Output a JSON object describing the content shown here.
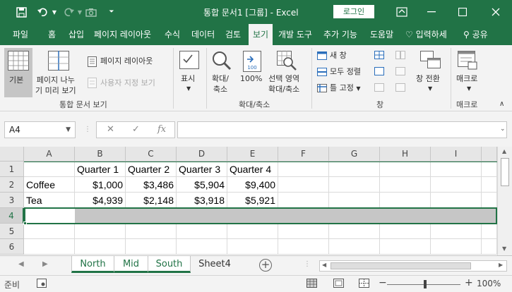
{
  "titlebar": {
    "title": "통합 문서1  [그룹]  -  Excel",
    "login_label": "로그인",
    "save_icon": "save-icon",
    "undo_icon": "undo-icon",
    "redo_icon": "redo-icon",
    "camera_icon": "camera-icon",
    "customize_icon": "customize-qat-icon"
  },
  "tabs": [
    "파일",
    "홈",
    "삽입",
    "페이지 레이아웃",
    "수식",
    "데이터",
    "검토",
    "보기",
    "개발 도구",
    "추가 기능",
    "도움말"
  ],
  "active_tab": "보기",
  "tell_me": "입력하세",
  "share": "공유",
  "ribbon": {
    "workbook_views": {
      "normal": "기본",
      "page_break_line1": "페이지 나누",
      "page_break_line2": "기 미리 보기",
      "page_layout": "페이지 레이아웃",
      "custom_views": "사용자 지정 보기",
      "label": "통합 문서 보기"
    },
    "show": {
      "label": "표시"
    },
    "zoom": {
      "zoom_line1": "확대/",
      "zoom_line2": "축소",
      "hundred": "100%",
      "selection_line1": "선택 영역",
      "selection_line2": "확대/축소",
      "label": "확대/축소"
    },
    "window": {
      "new_window": "새 창",
      "arrange_all": "모두 정렬",
      "freeze_panes": "틀 고정",
      "switch_windows": "창 전환",
      "label": "창"
    },
    "macros": {
      "macros": "매크로",
      "label": "매크로"
    }
  },
  "formula_bar": {
    "name_box": "A4",
    "fx": "fx",
    "value": ""
  },
  "columns": [
    "A",
    "B",
    "C",
    "D",
    "E",
    "F",
    "G",
    "H",
    "I"
  ],
  "rows": [
    "1",
    "2",
    "3",
    "4",
    "5",
    "6"
  ],
  "cells": {
    "r1": [
      "",
      "Quarter 1",
      "Quarter 2",
      "Quarter 3",
      "Quarter 4"
    ],
    "r2": [
      "Coffee",
      "$1,000",
      "$3,486",
      "$5,904",
      "$9,400"
    ],
    "r3": [
      "Tea",
      "$4,939",
      "$2,148",
      "$3,918",
      "$5,921"
    ]
  },
  "sheets": [
    "North",
    "Mid",
    "South",
    "Sheet4"
  ],
  "active_sheets": [
    "North",
    "Mid",
    "South"
  ],
  "status": {
    "ready": "준비",
    "zoom": "100%"
  },
  "colors": {
    "accent": "#217346"
  }
}
